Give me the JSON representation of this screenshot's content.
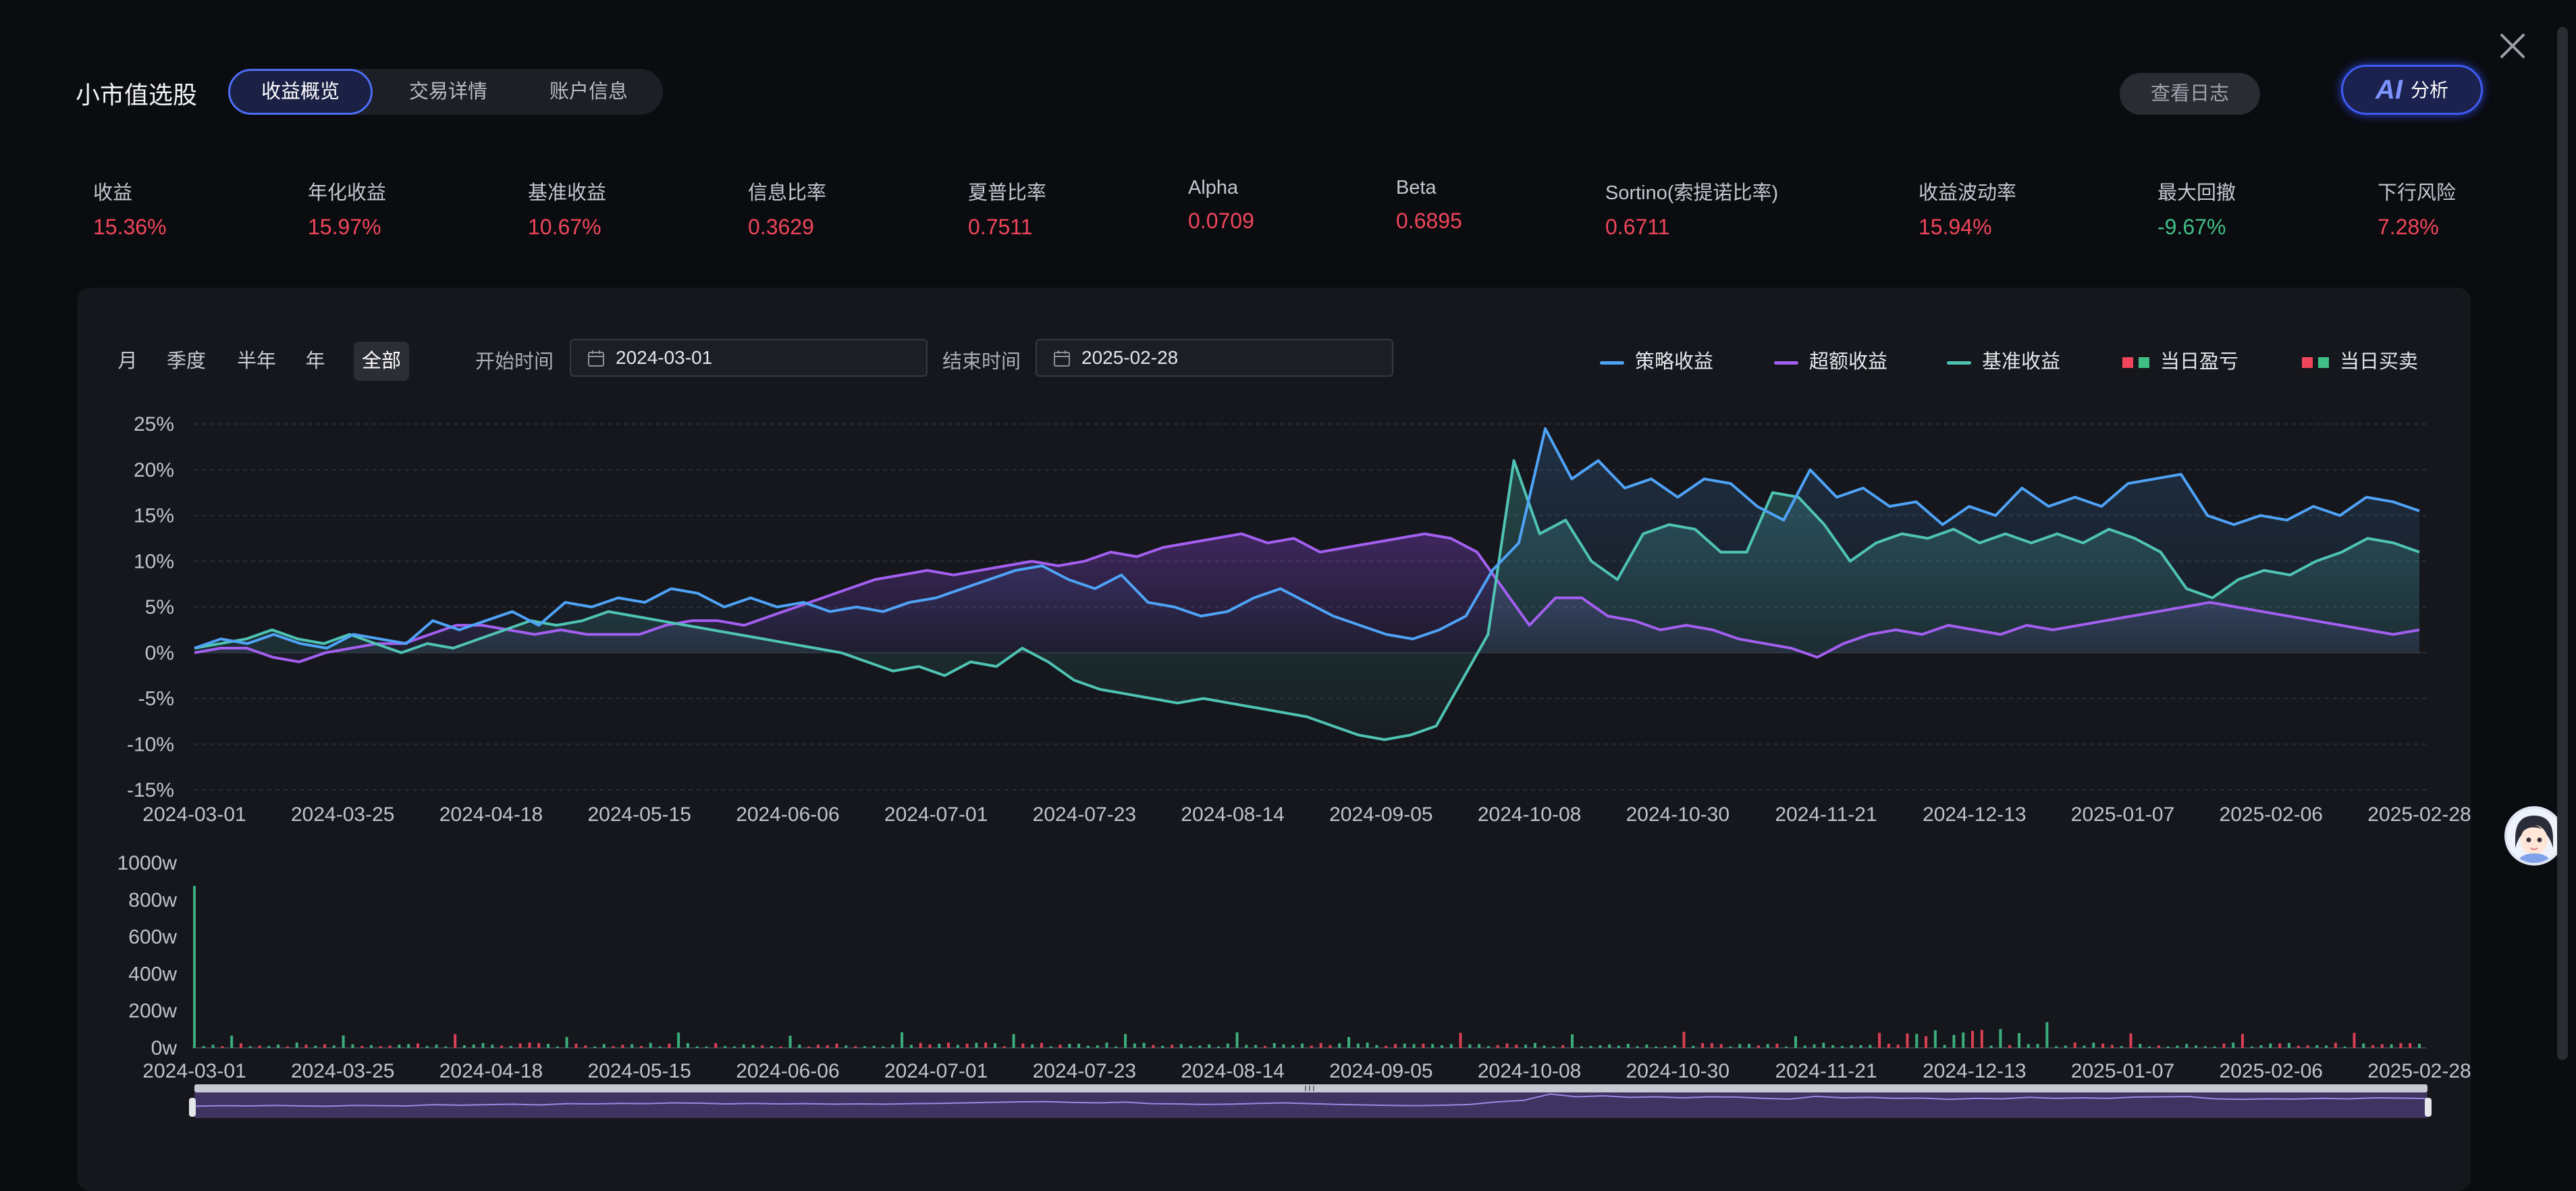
{
  "app_title": "小市值选股",
  "tabs": [
    {
      "label": "收益概览",
      "active": true
    },
    {
      "label": "交易详情",
      "active": false
    },
    {
      "label": "账户信息",
      "active": false
    }
  ],
  "header_actions": {
    "log_label": "查看日志",
    "ai_mark": "AI",
    "ai_label": "分析"
  },
  "metrics": [
    {
      "label": "收益",
      "value": "15.36%",
      "tone": "pos"
    },
    {
      "label": "年化收益",
      "value": "15.97%",
      "tone": "pos"
    },
    {
      "label": "基准收益",
      "value": "10.67%",
      "tone": "pos"
    },
    {
      "label": "信息比率",
      "value": "0.3629",
      "tone": "pos"
    },
    {
      "label": "夏普比率",
      "value": "0.7511",
      "tone": "pos"
    },
    {
      "label": "Alpha",
      "value": "0.0709",
      "tone": "pos"
    },
    {
      "label": "Beta",
      "value": "0.6895",
      "tone": "pos"
    },
    {
      "label": "Sortino(索提诺比率)",
      "value": "0.6711",
      "tone": "pos"
    },
    {
      "label": "收益波动率",
      "value": "15.94%",
      "tone": "pos"
    },
    {
      "label": "最大回撤",
      "value": "-9.67%",
      "tone": "neg"
    },
    {
      "label": "下行风险",
      "value": "7.28%",
      "tone": "pos"
    }
  ],
  "periods": [
    {
      "label": "月",
      "active": false
    },
    {
      "label": "季度",
      "active": false
    },
    {
      "label": "半年",
      "active": false
    },
    {
      "label": "年",
      "active": false
    },
    {
      "label": "全部",
      "active": true
    }
  ],
  "date_range": {
    "start_label": "开始时间",
    "start_value": "2024-03-01",
    "end_label": "结束时间",
    "end_value": "2025-02-28"
  },
  "colors": {
    "strategy": "#4fa3f7",
    "excess": "#a35ff0",
    "benchmark": "#4fc4b4",
    "up": "#f0455a",
    "down": "#3fbf86",
    "grid": "#2a2d35",
    "axis_text": "#bfc3cb"
  },
  "chart_data": {
    "type": "line",
    "title": "",
    "legend": [
      {
        "name": "策略收益",
        "kind": "line",
        "color": "#4fa3f7"
      },
      {
        "name": "超额收益",
        "kind": "line",
        "color": "#a35ff0"
      },
      {
        "name": "基准收益",
        "kind": "line",
        "color": "#4fc4b4"
      },
      {
        "name": "当日盈亏",
        "kind": "bar"
      },
      {
        "name": "当日买卖",
        "kind": "bar"
      }
    ],
    "legend_position": "top-right",
    "x_ticks": [
      "2024-03-01",
      "2024-03-25",
      "2024-04-18",
      "2024-05-15",
      "2024-06-06",
      "2024-07-01",
      "2024-07-23",
      "2024-08-14",
      "2024-09-05",
      "2024-10-08",
      "2024-10-30",
      "2024-11-21",
      "2024-12-13",
      "2025-01-07",
      "2025-02-06",
      "2025-02-28"
    ],
    "y_ticks": [
      "25%",
      "20%",
      "15%",
      "10%",
      "5%",
      "0%",
      "-5%",
      "-10%",
      "-15%"
    ],
    "ylim": [
      -15,
      25
    ],
    "grid": true,
    "series": [
      {
        "name": "策略收益",
        "values": [
          0.5,
          1.5,
          1.0,
          2.0,
          1.0,
          0.5,
          2.0,
          1.5,
          1.0,
          3.5,
          2.5,
          3.5,
          4.5,
          3.0,
          5.5,
          5.0,
          6.0,
          5.5,
          7.0,
          6.5,
          5.0,
          6.0,
          5.0,
          5.5,
          4.5,
          5.0,
          4.5,
          5.5,
          6.0,
          7.0,
          8.0,
          9.0,
          9.5,
          8.0,
          7.0,
          8.5,
          5.5,
          5.0,
          4.0,
          4.5,
          6.0,
          7.0,
          5.5,
          4.0,
          3.0,
          2.0,
          1.5,
          2.5,
          4.0,
          9.0,
          12.0,
          24.5,
          19.0,
          21.0,
          18.0,
          19.0,
          17.0,
          19.0,
          18.5,
          16.0,
          14.5,
          20.0,
          17.0,
          18.0,
          16.0,
          16.5,
          14.0,
          16.0,
          15.0,
          18.0,
          16.0,
          17.0,
          16.0,
          18.5,
          19.0,
          19.5,
          15.0,
          14.0,
          15.0,
          14.5,
          16.0,
          15.0,
          17.0,
          16.5,
          15.5
        ]
      },
      {
        "name": "超额收益",
        "values": [
          0.0,
          0.5,
          0.5,
          -0.5,
          -1.0,
          0.0,
          0.5,
          1.0,
          1.0,
          2.0,
          3.0,
          3.0,
          2.5,
          2.0,
          2.5,
          2.0,
          2.0,
          2.0,
          3.0,
          3.5,
          3.5,
          3.0,
          4.0,
          5.0,
          6.0,
          7.0,
          8.0,
          8.5,
          9.0,
          8.5,
          9.0,
          9.5,
          10.0,
          9.5,
          10.0,
          11.0,
          10.5,
          11.5,
          12.0,
          12.5,
          13.0,
          12.0,
          12.5,
          11.0,
          11.5,
          12.0,
          12.5,
          13.0,
          12.5,
          11.0,
          7.0,
          3.0,
          6.0,
          6.0,
          4.0,
          3.5,
          2.5,
          3.0,
          2.5,
          1.5,
          1.0,
          0.5,
          -0.5,
          1.0,
          2.0,
          2.5,
          2.0,
          3.0,
          2.5,
          2.0,
          3.0,
          2.5,
          3.0,
          3.5,
          4.0,
          4.5,
          5.0,
          5.5,
          5.0,
          4.5,
          4.0,
          3.5,
          3.0,
          2.5,
          2.0,
          2.5
        ]
      },
      {
        "name": "基准收益",
        "values": [
          0.5,
          1.0,
          1.5,
          2.5,
          1.5,
          1.0,
          2.0,
          1.0,
          0.0,
          1.0,
          0.5,
          1.5,
          2.5,
          3.5,
          3.0,
          3.5,
          4.5,
          4.0,
          3.5,
          3.0,
          2.5,
          2.0,
          1.5,
          1.0,
          0.5,
          0.0,
          -1.0,
          -2.0,
          -1.5,
          -2.5,
          -1.0,
          -1.5,
          0.5,
          -1.0,
          -3.0,
          -4.0,
          -4.5,
          -5.0,
          -5.5,
          -5.0,
          -5.5,
          -6.0,
          -6.5,
          -7.0,
          -8.0,
          -9.0,
          -9.5,
          -9.0,
          -8.0,
          -3.0,
          2.0,
          21.0,
          13.0,
          14.5,
          10.0,
          8.0,
          13.0,
          14.0,
          13.5,
          11.0,
          11.0,
          17.5,
          17.0,
          14.0,
          10.0,
          12.0,
          13.0,
          12.5,
          13.5,
          12.0,
          13.0,
          12.0,
          13.0,
          12.0,
          13.5,
          12.5,
          11.0,
          7.0,
          6.0,
          8.0,
          9.0,
          8.5,
          10.0,
          11.0,
          12.5,
          12.0,
          11.0
        ]
      }
    ],
    "volume": {
      "y_ticks": [
        "1000w",
        "800w",
        "600w",
        "400w",
        "200w",
        "0w"
      ],
      "ylim": [
        0,
        1000
      ],
      "x_ticks": [
        "2024-03-01",
        "2024-03-25",
        "2024-04-18",
        "2024-05-15",
        "2024-06-06",
        "2024-07-01",
        "2024-07-23",
        "2024-08-14",
        "2024-09-05",
        "2024-10-08",
        "2024-10-30",
        "2024-11-21",
        "2024-12-13",
        "2025-01-07",
        "2025-02-06",
        "2025-02-28"
      ]
    }
  }
}
